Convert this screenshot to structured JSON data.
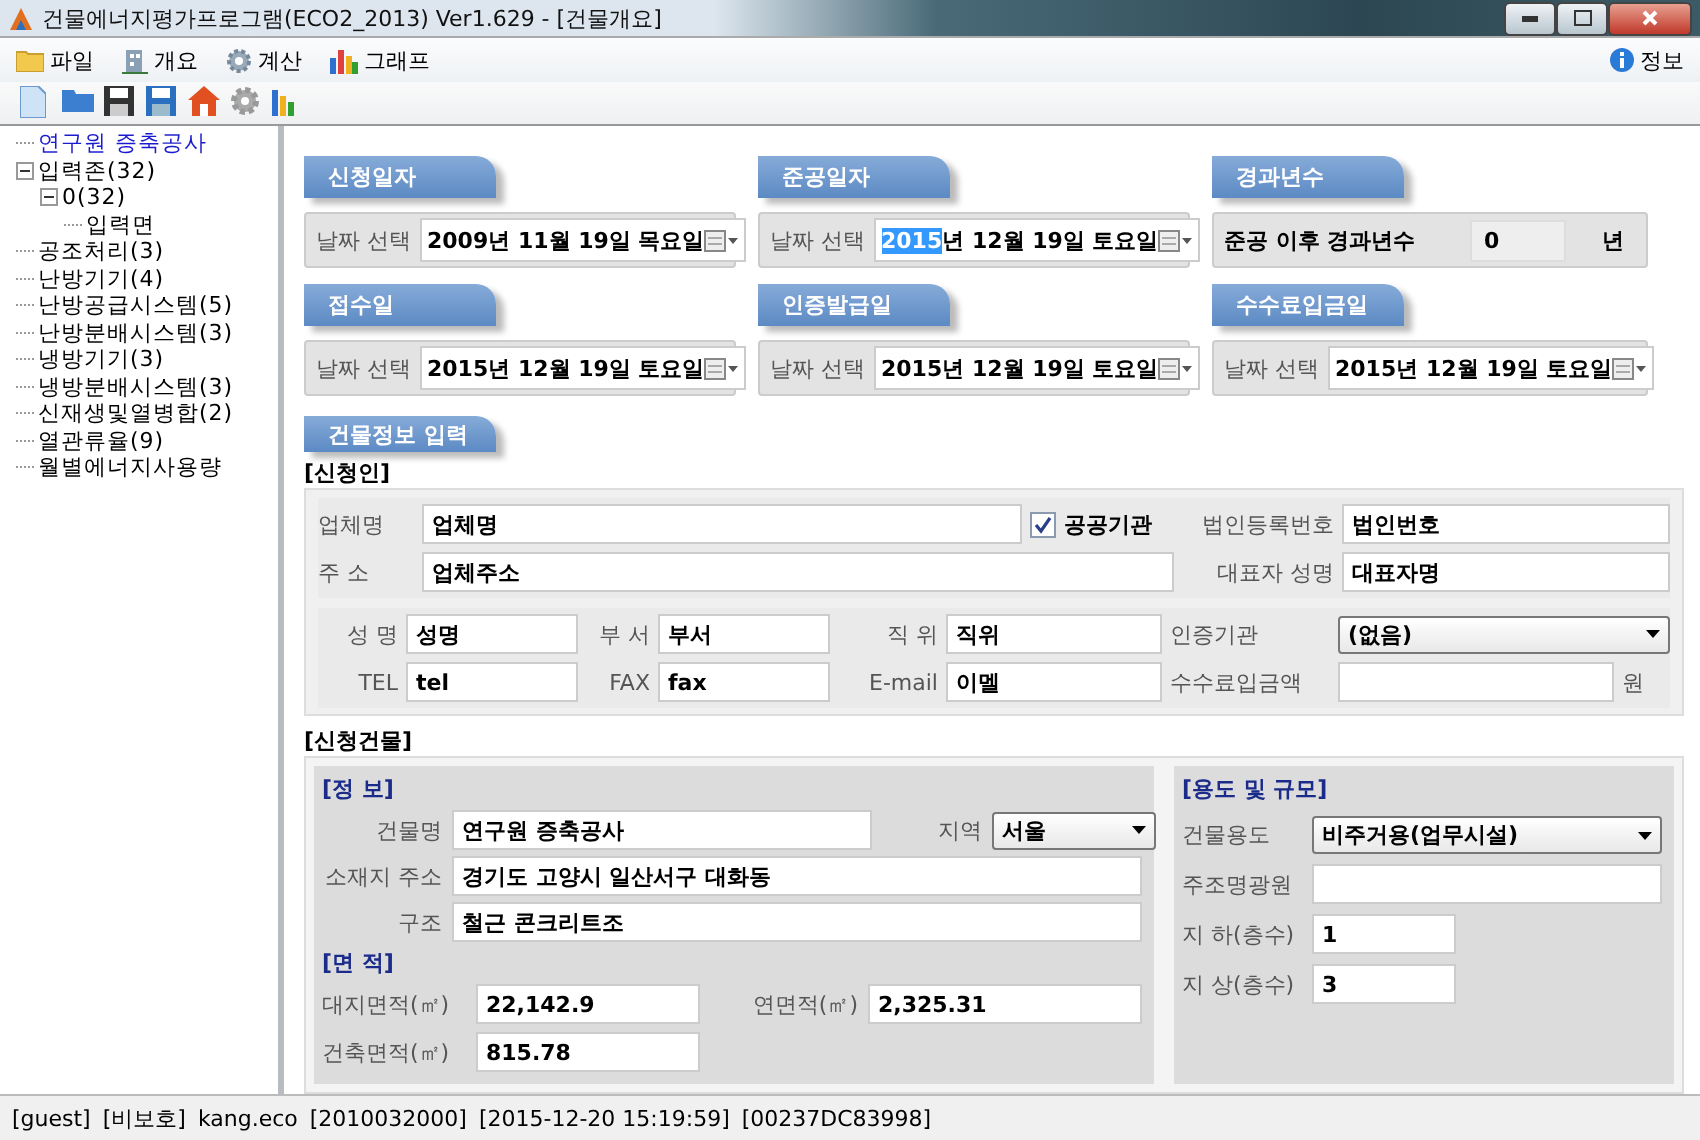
{
  "window": {
    "title": "건물에너지평가프로그램(ECO2_2013) Ver1.629 - [건물개요]"
  },
  "menu": [
    {
      "label": "파일",
      "kind": "folder"
    },
    {
      "label": "개요",
      "kind": "building"
    },
    {
      "label": "계산",
      "kind": "gear"
    },
    {
      "label": "그래프",
      "kind": "chart"
    }
  ],
  "info_menu": {
    "label": "정보"
  },
  "tree": [
    {
      "label": "연구원 증축공사",
      "selected": true
    },
    {
      "label": "입력존(32)",
      "selected": false,
      "expanded": true,
      "children": [
        {
          "label": "0(32)",
          "selected": false,
          "expanded": true,
          "children": [
            {
              "label": "입력면",
              "selected": false
            }
          ]
        }
      ]
    },
    {
      "label": "공조처리(3)",
      "selected": false
    },
    {
      "label": "난방기기(4)",
      "selected": false
    },
    {
      "label": "난방공급시스템(5)",
      "selected": false
    },
    {
      "label": "난방분배시스템(3)",
      "selected": false
    },
    {
      "label": "냉방기기(3)",
      "selected": false
    },
    {
      "label": "냉방분배시스템(3)",
      "selected": false
    },
    {
      "label": "신재생및열병합(2)",
      "selected": false
    },
    {
      "label": "열관류율(9)",
      "selected": false
    },
    {
      "label": "월별에너지사용량",
      "selected": false
    }
  ],
  "date_panels": [
    {
      "title": "신청일자",
      "kind": "date",
      "label": "날짜 선택",
      "value": "2009년 11월 19일 목요일"
    },
    {
      "title": "준공일자",
      "kind": "date",
      "label": "날짜 선택",
      "selected_text": "2015",
      "value": "년 12월 19일 토요일"
    },
    {
      "title": "경과년수",
      "kind": "years",
      "label": "준공 이후 경과년수",
      "value": "0",
      "unit": "년"
    },
    {
      "title": "접수일",
      "kind": "date",
      "label": "날짜 선택",
      "value": "2015년 12월 19일 토요일"
    },
    {
      "title": "인증발급일",
      "kind": "date",
      "label": "날짜 선택",
      "value": "2015년 12월 19일 토요일"
    },
    {
      "title": "수수료입금일",
      "kind": "date",
      "label": "날짜 선택",
      "value": "2015년 12월 19일 토요일"
    }
  ],
  "building_info_tab": "건물정보 입력",
  "applicant": {
    "heading": "[신청인]",
    "company": {
      "label": "업체명",
      "value": "업체명"
    },
    "public_agency": {
      "label": "공공기관",
      "checked": true
    },
    "corp_number": {
      "label": "법인등록번호",
      "value": "법인번호"
    },
    "address": {
      "label": "주 소",
      "value": "업체주소"
    },
    "ceo": {
      "label": "대표자 성명",
      "value": "대표자명"
    },
    "contact": [
      {
        "label": "성 명",
        "value": "성명",
        "kind": "text"
      },
      {
        "label": "부 서",
        "value": "부서",
        "kind": "text"
      },
      {
        "label": "직 위",
        "value": "직위",
        "kind": "text"
      },
      {
        "label": "인증기관",
        "value": "(없음)",
        "kind": "select"
      },
      {
        "label": "TEL",
        "value": "tel",
        "kind": "text"
      },
      {
        "label": "FAX",
        "value": "fax",
        "kind": "text"
      },
      {
        "label": "E-mail",
        "value": "이멜",
        "kind": "text"
      },
      {
        "label": "수수료입금액",
        "kind": "text",
        "unit": "원"
      }
    ]
  },
  "building": {
    "heading": "[신청건물]",
    "info": {
      "heading": "[정  보]",
      "name": {
        "label": "건물명",
        "value": "연구원 증축공사"
      },
      "region": {
        "label": "지역",
        "value": "서울"
      },
      "location": {
        "label": "소재지 주소",
        "value": "경기도 고양시 일산서구 대화동"
      },
      "structure": {
        "label": "구조",
        "value": "철근 콘크리트조"
      }
    },
    "area": {
      "heading": "[면  적]",
      "fields": [
        {
          "label": "대지면적(㎡)",
          "value": "22,142.9"
        },
        {
          "label": "연면적(㎡)",
          "value": "2,325.31"
        },
        {
          "label": "건축면적(㎡)",
          "value": "815.78"
        }
      ]
    },
    "use": {
      "heading": "[용도 및 규모]",
      "fields": [
        {
          "label": "건물용도",
          "value": "비주거용(업무시설)",
          "kind": "select"
        },
        {
          "label": "주조명광원",
          "kind": "text"
        },
        {
          "label": "지 하(층수)",
          "value": "1",
          "kind": "short"
        },
        {
          "label": "지 상(층수)",
          "value": "3",
          "kind": "short"
        }
      ]
    }
  },
  "status_bar": [
    "[guest]",
    "[비보호]",
    "kang.eco",
    "[2010032000]",
    "[2015-12-20 15:19:59]",
    "[00237DC83998]"
  ]
}
